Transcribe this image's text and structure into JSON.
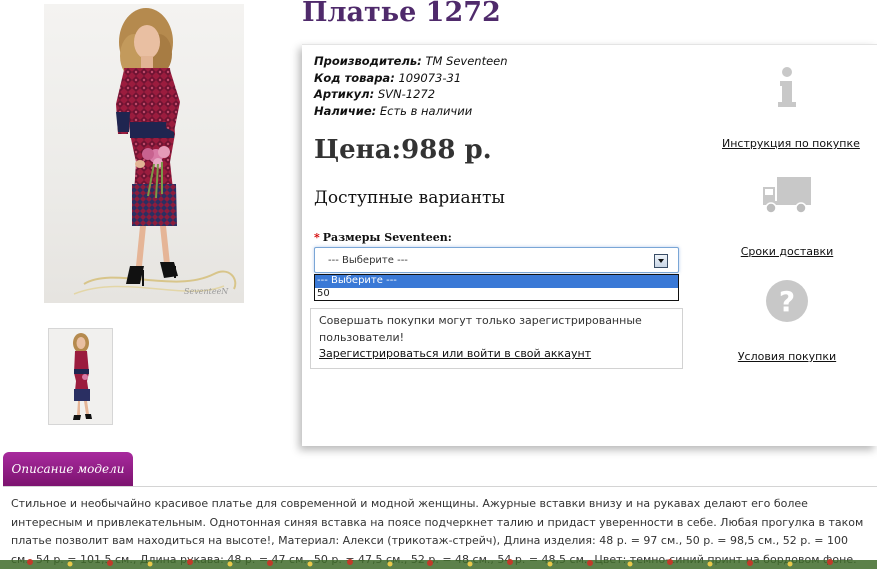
{
  "product": {
    "title": "Платье 1272",
    "specs": [
      {
        "label": "Производитель:",
        "value": "ТМ Seventeen"
      },
      {
        "label": "Код товара:",
        "value": "109073-31"
      },
      {
        "label": "Артикул:",
        "value": "SVN-1272"
      },
      {
        "label": "Наличие:",
        "value": "Есть в наличии"
      }
    ],
    "price": "Цена:988 р."
  },
  "variants": {
    "title": "Доступные варианты",
    "size_required_mark": "*",
    "size_label": "Размеры Seventeen:",
    "selected": "--- Выберите ---",
    "options": [
      "--- Выберите ---",
      "50"
    ],
    "highlighted_option_index": 0
  },
  "login_note": {
    "text": "Совершать покупки могут только зарегистрированные пользователи!",
    "link": "Зарегистрироваться или войти в свой аккаунт"
  },
  "side_links": [
    {
      "icon": "info-icon",
      "label": "Инструкция по покупке"
    },
    {
      "icon": "truck-icon",
      "label": "Сроки доставки"
    },
    {
      "icon": "question-icon",
      "label": "Условия покупки"
    }
  ],
  "description": {
    "tab_label": "Описание модели",
    "text": "Стильное и необычайно красивое платье для современной и модной женщины. Ажурные вставки внизу и на рукавах делают его более интересным и привлекательным. Однотонная синяя вставка на поясе подчеркнет талию и придаст уверенности в себе. Любая прогулка в таком платье позволит вам находиться на высоте!, Материал: Алекси (трикотаж-стрейч), Длина изделия: 48 р. = 97 см., 50 р. = 98,5 см., 52 р. = 100 см., 54 р. = 101,5 см., Длина рукава: 48 р. = 47 см., 50 р. = 47,5 см., 52 р. = 48 см., 54 р. = 48,5 см., Цвет: темно-синий принт на бордовом фоне."
  },
  "colors": {
    "title": "#4f2a6b",
    "tab": "#8f1f84",
    "required": "#d40000",
    "highlight": "#3a79d6",
    "dress_red": "#9b1c3e",
    "dress_navy": "#1f2550"
  }
}
